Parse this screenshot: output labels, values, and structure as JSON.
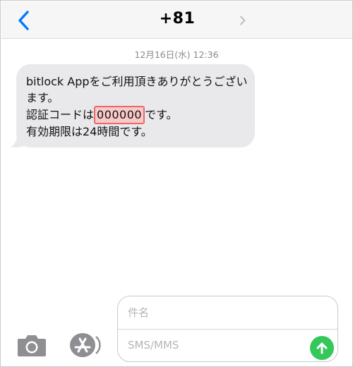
{
  "header": {
    "contact": "+81",
    "back_icon": "chevron-left-icon",
    "detail_icon": "chevron-right-icon"
  },
  "thread": {
    "date": "12月16日(水)",
    "time": "12:36",
    "message": {
      "line1": "bitlock Appをご利用頂きありがとうございます。",
      "line2_prefix": "認証コードは",
      "code": "000000",
      "line2_suffix": "です。",
      "line3": "有効期限は24時間です。"
    }
  },
  "compose": {
    "subject_placeholder": "件名",
    "message_placeholder": "SMS/MMS",
    "camera_icon": "camera-icon",
    "appstore_icon": "app-store-icon",
    "send_icon": "arrow-up-icon"
  },
  "colors": {
    "accent_blue": "#007aff",
    "bubble_gray": "#e9e9eb",
    "send_green": "#34c759",
    "highlight_border": "#e86a6a",
    "highlight_fill": "#f9c9c9"
  }
}
